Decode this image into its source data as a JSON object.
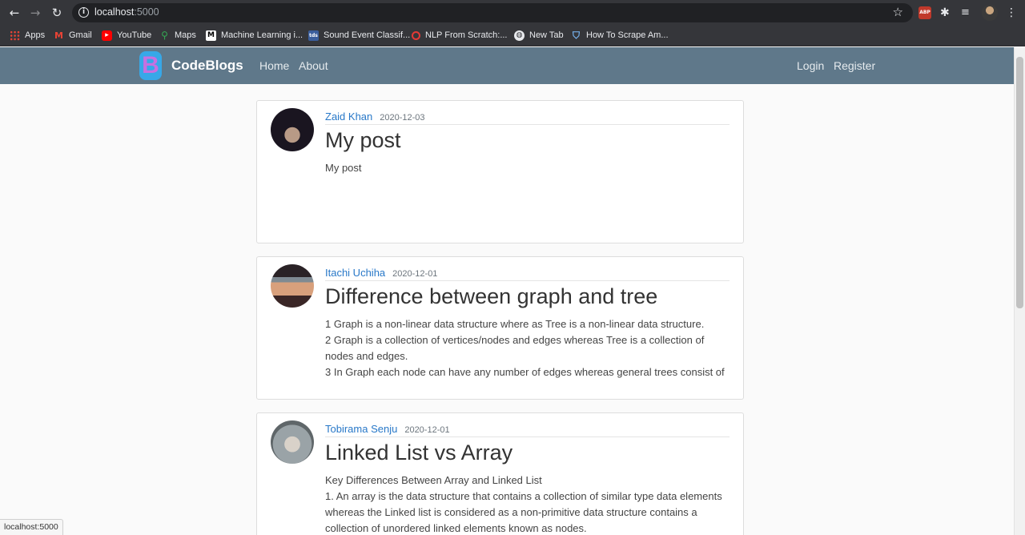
{
  "browser": {
    "url_host": "localhost",
    "url_port": ":5000",
    "bookmarks": [
      {
        "label": "Apps",
        "icon": "apps-grid-icon"
      },
      {
        "label": "Gmail",
        "icon": "gmail-icon"
      },
      {
        "label": "YouTube",
        "icon": "youtube-icon"
      },
      {
        "label": "Maps",
        "icon": "maps-icon"
      },
      {
        "label": "Machine Learning i...",
        "icon": "medium-icon"
      },
      {
        "label": "Sound Event Classif...",
        "icon": "site-icon"
      },
      {
        "label": "NLP From Scratch:...",
        "icon": "pytorch-icon"
      },
      {
        "label": "New Tab",
        "icon": "globe-icon"
      },
      {
        "label": "How To Scrape Am...",
        "icon": "shield-icon"
      }
    ],
    "extension_abp": "ABP",
    "status_url": "localhost:5000"
  },
  "site": {
    "brand": "CodeBlogs",
    "logo_letter": "B",
    "nav": {
      "home": "Home",
      "about": "About",
      "login": "Login",
      "register": "Register"
    }
  },
  "posts": [
    {
      "author": "Zaid Khan",
      "date": "2020-12-03",
      "title": "My post",
      "lines": [
        "My post"
      ]
    },
    {
      "author": "Itachi Uchiha",
      "date": "2020-12-01",
      "title": "Difference between graph and tree",
      "lines": [
        "1 Graph is a non-linear data structure where as Tree is a non-linear data structure.",
        "2 Graph is a collection of vertices/nodes and edges whereas Tree is a collection of nodes and edges.",
        "3 In Graph each node can have any number of edges whereas general trees consist of"
      ]
    },
    {
      "author": "Tobirama Senju",
      "date": "2020-12-01",
      "title": "Linked List vs Array",
      "lines": [
        "Key Differences Between Array and Linked List",
        "1. An array is the data structure that contains a collection of similar type data elements whereas the Linked list is considered as a non-primitive data structure contains a collection of unordered linked elements known as nodes."
      ]
    }
  ]
}
